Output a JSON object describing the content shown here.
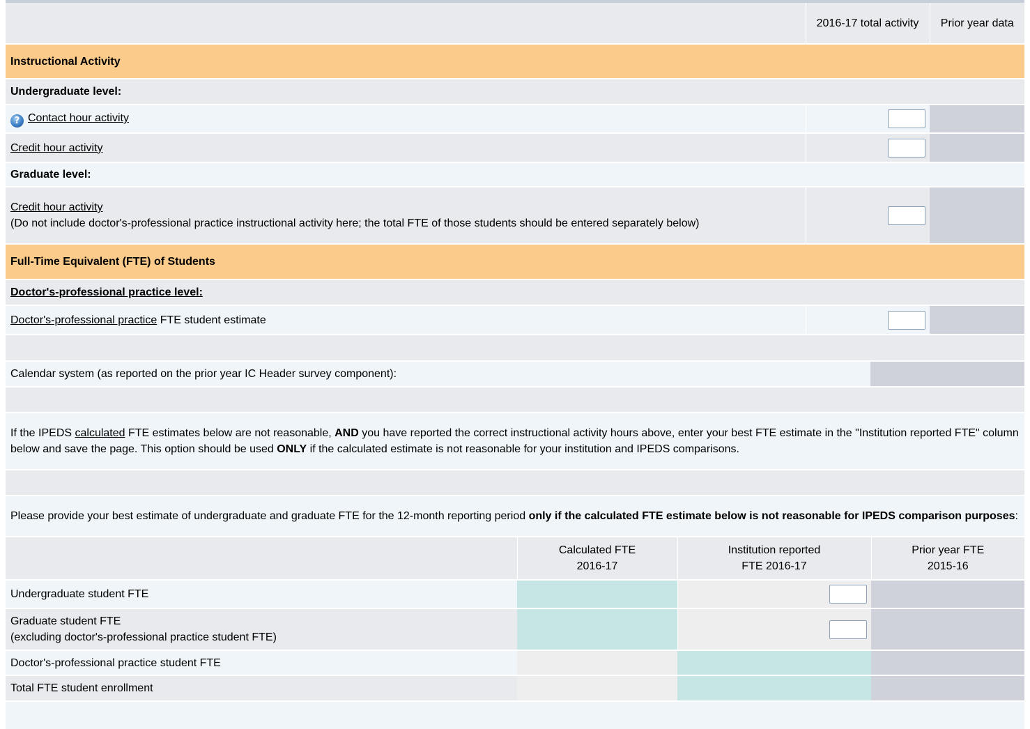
{
  "header": {
    "col_total": "2016-17 total activity",
    "col_prior": "Prior year data"
  },
  "instructional": {
    "section_title": "Instructional Activity",
    "undergrad_heading": "Undergraduate level:",
    "contact_hour_label": "Contact hour activity",
    "ug_credit_hour_label": "Credit hour activity",
    "grad_heading": "Graduate level:",
    "grad_credit_hour_label": "Credit hour activity",
    "grad_note": "(Do not include doctor's-professional practice instructional activity here; the total FTE of those students should be entered separately below)"
  },
  "fte": {
    "section_title": "Full-Time Equivalent (FTE) of Students",
    "doc_heading": "Doctor's-professional practice level:",
    "doc_link": "Doctor's-professional practice",
    "doc_suffix": " FTE student estimate"
  },
  "calendar": {
    "label": "Calendar system (as reported on the prior year IC Header survey component):",
    "value": ""
  },
  "instructions": {
    "p1_a": "If the IPEDS ",
    "p1_link": "calculated",
    "p1_b": " FTE estimates below are not reasonable, ",
    "p1_bold1": "AND",
    "p1_c": " you have reported the correct instructional activity hours above, enter your best FTE estimate in the \"Institution reported FTE\" column below and save the page. This option should be used ",
    "p1_bold2": "ONLY",
    "p1_d": " if the calculated estimate is not reasonable for your institution and IPEDS comparisons.",
    "p2_a": "Please provide your best estimate of undergraduate and graduate FTE for the 12-month reporting period ",
    "p2_bold": "only if the calculated FTE estimate below is not reasonable for IPEDS comparison purposes",
    "p2_b": ":"
  },
  "fte_table": {
    "col_calc_1": "Calculated FTE",
    "col_calc_2": "2016-17",
    "col_inst_1": "Institution reported",
    "col_inst_2": "FTE 2016-17",
    "col_prior_1": "Prior year FTE",
    "col_prior_2": "2015-16",
    "rows": [
      {
        "label": "Undergraduate student FTE"
      },
      {
        "label": "Graduate student FTE",
        "sub": "(excluding doctor's-professional practice student FTE)"
      },
      {
        "label": "Doctor's-professional practice student FTE"
      },
      {
        "label": "Total FTE student enrollment"
      }
    ]
  },
  "colors": {
    "section_header": "#fbcb8b",
    "prior_year_cell": "#cfd1db",
    "calculated_cell": "#c6e6e6"
  }
}
